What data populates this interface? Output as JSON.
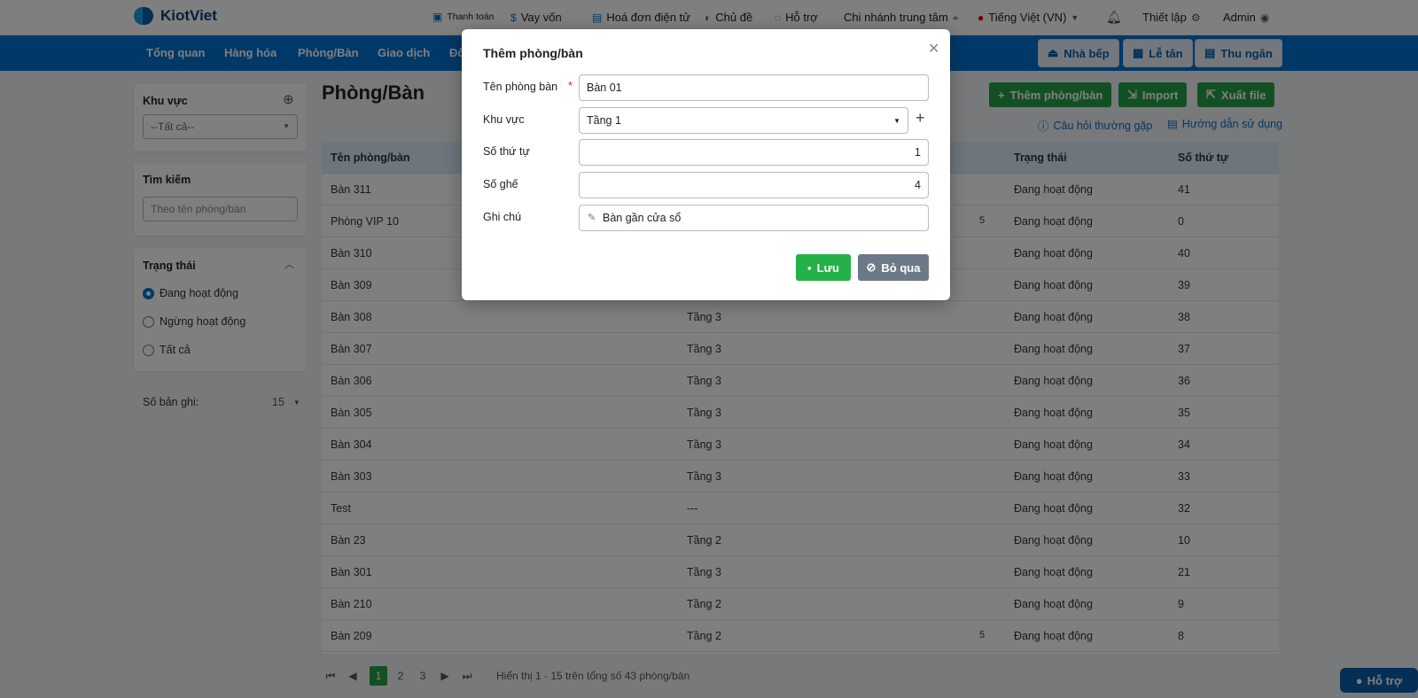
{
  "app": {
    "logo": "KiotViet"
  },
  "toplinks": [
    {
      "label": "Thanh toán",
      "icon": "payment-icon"
    },
    {
      "label": "Vay vốn",
      "icon": "loan-icon"
    },
    {
      "label": "Hoá đơn điện tử",
      "icon": "invoice-icon"
    },
    {
      "label": "Chủ đề",
      "icon": "palette-icon"
    },
    {
      "label": "Hỗ trợ",
      "icon": "chat-icon"
    },
    {
      "label": "Chi nhánh trung tâm",
      "icon": "location-icon"
    },
    {
      "label": "Tiếng Việt (VN)",
      "icon": "flag-vn-icon"
    },
    {
      "label": "Thiết lập",
      "icon": "gear-icon"
    },
    {
      "label": "Admin",
      "icon": "user-icon"
    }
  ],
  "nav": {
    "items": [
      "Tổng quan",
      "Hàng hóa",
      "Phòng/Bàn",
      "Giao dịch",
      "Đố"
    ],
    "buttons": [
      "Nhà bếp",
      "Lễ tân",
      "Thu ngân"
    ]
  },
  "sidebar": {
    "area_title": "Khu vực",
    "area_select": "--Tất cả--",
    "search_title": "Tìm kiếm",
    "search_placeholder": "Theo tên phòng/bàn",
    "status_title": "Trạng thái",
    "status_options": [
      "Đang hoạt động",
      "Ngừng hoạt động",
      "Tất cả"
    ],
    "records_label": "Số bản ghi:",
    "records_value": "15"
  },
  "main": {
    "title": "Phòng/Bàn",
    "actions": [
      "Thêm phòng/bàn",
      "Import",
      "Xuất file"
    ],
    "faq": "Câu hỏi thường gặp",
    "guide": "Hướng dẫn sử dụng",
    "headers": [
      "Tên phòng/bàn",
      "Trạng thái",
      "Số thứ tự"
    ],
    "rows": [
      {
        "name": "Bàn 311",
        "area": "",
        "seats": "",
        "status": "Đang hoạt động",
        "order": "41"
      },
      {
        "name": "Phòng VIP 10",
        "area": "",
        "seats": "5",
        "status": "Đang hoạt động",
        "order": "0"
      },
      {
        "name": "Bàn 310",
        "area": "",
        "seats": "",
        "status": "Đang hoạt động",
        "order": "40"
      },
      {
        "name": "Bàn 309",
        "area": "",
        "seats": "",
        "status": "Đang hoạt động",
        "order": "39"
      },
      {
        "name": "Bàn 308",
        "area": "Tầng 3",
        "seats": "",
        "status": "Đang hoạt động",
        "order": "38"
      },
      {
        "name": "Bàn 307",
        "area": "Tầng 3",
        "seats": "",
        "status": "Đang hoạt động",
        "order": "37"
      },
      {
        "name": "Bàn 306",
        "area": "Tầng 3",
        "seats": "",
        "status": "Đang hoạt động",
        "order": "36"
      },
      {
        "name": "Bàn 305",
        "area": "Tầng 3",
        "seats": "",
        "status": "Đang hoạt động",
        "order": "35"
      },
      {
        "name": "Bàn 304",
        "area": "Tầng 3",
        "seats": "",
        "status": "Đang hoạt động",
        "order": "34"
      },
      {
        "name": "Bàn 303",
        "area": "Tầng 3",
        "seats": "",
        "status": "Đang hoạt động",
        "order": "33"
      },
      {
        "name": "Test",
        "area": "---",
        "seats": "",
        "status": "Đang hoạt động",
        "order": "32"
      },
      {
        "name": "Bàn 23",
        "area": "Tầng 2",
        "seats": "",
        "status": "Đang hoạt động",
        "order": "10"
      },
      {
        "name": "Bàn 301",
        "area": "Tầng 3",
        "seats": "",
        "status": "Đang hoạt động",
        "order": "21"
      },
      {
        "name": "Bàn 210",
        "area": "Tầng 2",
        "seats": "",
        "status": "Đang hoạt động",
        "order": "9"
      },
      {
        "name": "Bàn 209",
        "area": "Tầng 2",
        "seats": "5",
        "status": "Đang hoạt động",
        "order": "8"
      }
    ],
    "pagination": {
      "pages": [
        "1",
        "2",
        "3"
      ],
      "summary": "Hiển thị 1 - 15 trên tổng số 43 phòng/bàn"
    }
  },
  "modal": {
    "title": "Thêm phòng/bàn",
    "name_label": "Tên phòng bàn",
    "name_value": "Bàn 01",
    "area_label": "Khu vực",
    "area_value": "Tầng 1",
    "order_label": "Số thứ tự",
    "order_value": "1",
    "seats_label": "Số ghế",
    "seats_value": "4",
    "note_label": "Ghi chú",
    "note_value": "Bàn gần cửa sổ",
    "save": "Lưu",
    "cancel": "Bỏ qua"
  },
  "support_chat": "Hỗ trợ",
  "colors": {
    "primary": "#0070d0",
    "success": "#24a148",
    "modal_overlay": "#000000"
  }
}
